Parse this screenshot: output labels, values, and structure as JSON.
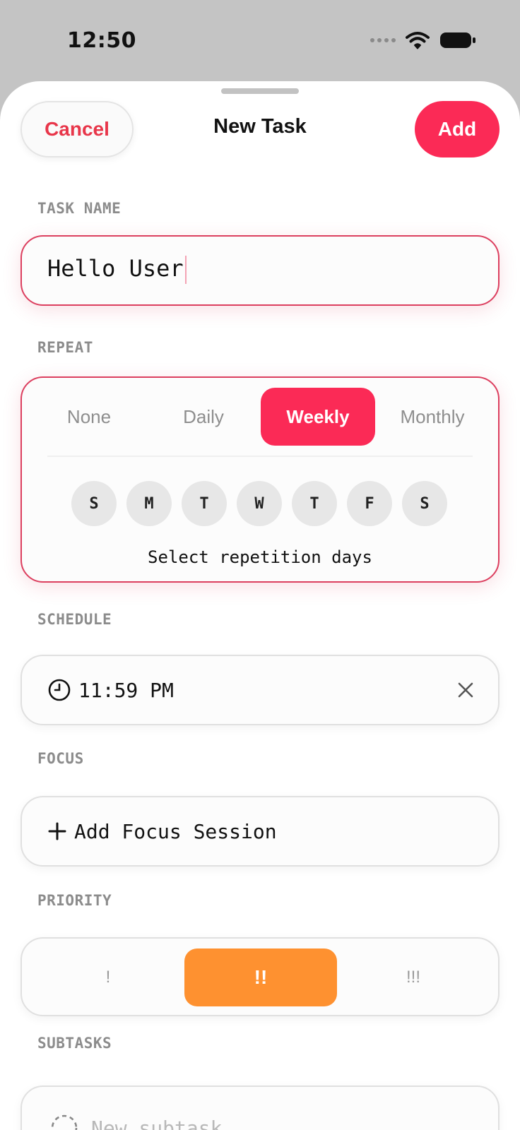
{
  "status_bar": {
    "time": "12:50"
  },
  "header": {
    "cancel_label": "Cancel",
    "title": "New Task",
    "add_label": "Add"
  },
  "task_name": {
    "label": "TASK NAME",
    "value": "Hello User"
  },
  "repeat": {
    "label": "REPEAT",
    "options": [
      "None",
      "Daily",
      "Weekly",
      "Monthly"
    ],
    "selected": "Weekly",
    "days": [
      "S",
      "M",
      "T",
      "W",
      "T",
      "F",
      "S"
    ],
    "hint": "Select repetition days"
  },
  "schedule": {
    "label": "SCHEDULE",
    "time": "11:59 PM"
  },
  "focus": {
    "label": "FOCUS",
    "add_label": "Add Focus Session"
  },
  "priority": {
    "label": "PRIORITY",
    "options": [
      "!",
      "!!",
      "!!!"
    ],
    "selected": "!!"
  },
  "subtasks": {
    "label": "SUBTASKS",
    "placeholder": "New subtask"
  },
  "colors": {
    "accent": "#fb2a56",
    "priority": "#fe9130",
    "cancel_text": "#e8364a"
  },
  "icons": [
    "wifi-icon",
    "battery-icon",
    "clock-icon",
    "close-icon",
    "plus-icon",
    "dashed-circle-icon"
  ]
}
